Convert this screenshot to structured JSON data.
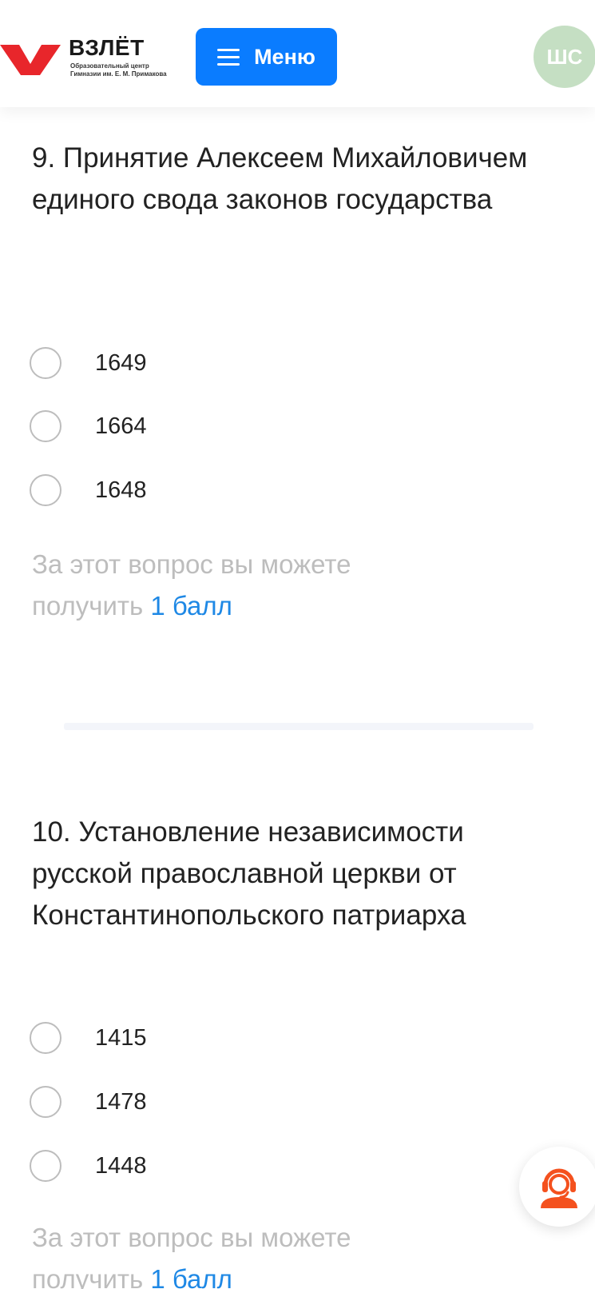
{
  "header": {
    "logo": {
      "title": "ВЗЛЁТ",
      "subtitle_line1": "Образовательный центр",
      "subtitle_line2": "Гимназии им. Е. М. Примакова",
      "mark_color": "#e8262b"
    },
    "menu_button": {
      "label": "Меню",
      "color": "#0a7cff"
    },
    "avatar": {
      "initials": "ШС",
      "color": "#c5dfc3"
    }
  },
  "questions": [
    {
      "title": "9. Принятие Алексеем Михайловичем единого свода законов государства",
      "options": [
        "1649",
        "1664",
        "1648"
      ],
      "points_prefix": "За этот вопрос вы можете получить",
      "points_value": "1 балл"
    },
    {
      "title": "10. Установление независимости русской православной церкви от Константинопольского патриарха",
      "options": [
        "1415",
        "1478",
        "1448"
      ],
      "points_prefix": "За этот вопрос вы можете получить",
      "points_value": "1 балл"
    }
  ],
  "support": {
    "icon": "headset-support-icon",
    "color": "#f4511e"
  }
}
